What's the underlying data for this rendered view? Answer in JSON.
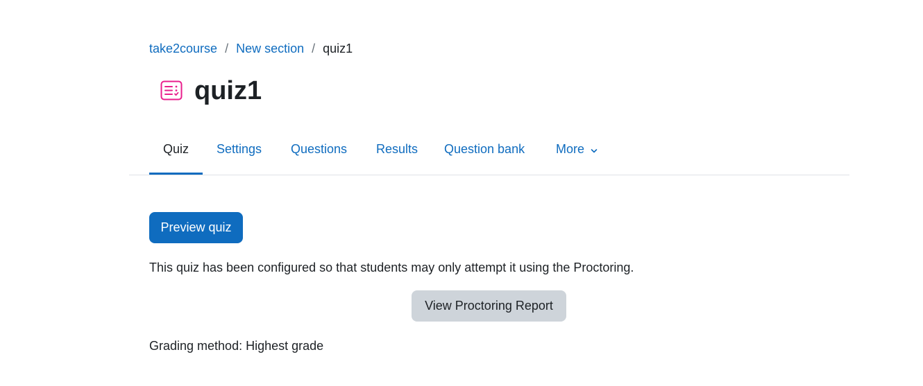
{
  "breadcrumb": {
    "items": [
      {
        "label": "take2course"
      },
      {
        "label": "New section"
      },
      {
        "label": "quiz1"
      }
    ],
    "separator": "/"
  },
  "header": {
    "title": "quiz1",
    "icon": "quiz-icon",
    "icon_color": "#e91e8c"
  },
  "tabs": [
    {
      "label": "Quiz",
      "active": true
    },
    {
      "label": "Settings"
    },
    {
      "label": "Questions"
    },
    {
      "label": "Results"
    },
    {
      "label": "Question bank"
    },
    {
      "label": "More",
      "icon": "chevron-down-icon"
    }
  ],
  "main": {
    "preview_button": "Preview quiz",
    "info_text": "This quiz has been configured so that students may only attempt it using the Proctoring.",
    "report_button": "View Proctoring Report",
    "grading_method": "Grading method: Highest grade"
  },
  "colors": {
    "accent": "#0f6cbf",
    "text": "#1d2125",
    "secondary_button": "#ced4da",
    "divider": "#dee2e6"
  }
}
